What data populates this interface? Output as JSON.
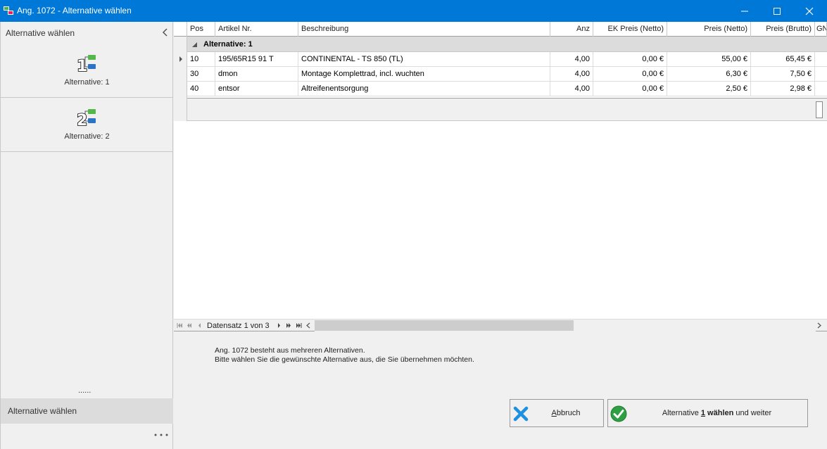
{
  "window": {
    "title": "Ang. 1072 - Alternative wählen"
  },
  "left_panel": {
    "header": "Alternative wählen",
    "items": [
      {
        "label": "Alternative: 1",
        "number": "1"
      },
      {
        "label": "Alternative: 2",
        "number": "2"
      }
    ],
    "dots": "......",
    "footer": "Alternative wählen"
  },
  "grid": {
    "columns": [
      "Pos",
      "Artikel Nr.",
      "Beschreibung",
      "Anz",
      "EK Preis (Netto)",
      "Preis (Netto)",
      "Preis (Brutto)",
      "GN"
    ],
    "group_label": "Alternative: 1",
    "rows": [
      {
        "pos": "10",
        "artikel": "195/65R15 91 T",
        "beschreibung": "CONTINENTAL - TS 850 (TL)",
        "anz": "4,00",
        "ek": "0,00 €",
        "netto": "55,00 €",
        "brutto": "65,45 €"
      },
      {
        "pos": "30",
        "artikel": "dmon",
        "beschreibung": "Montage Komplettrad, incl. wuchten",
        "anz": "4,00",
        "ek": "0,00 €",
        "netto": "6,30 €",
        "brutto": "7,50 €"
      },
      {
        "pos": "40",
        "artikel": "entsor",
        "beschreibung": "Altreifenentsorgung",
        "anz": "4,00",
        "ek": "0,00 €",
        "netto": "2,50 €",
        "brutto": "2,98 €"
      }
    ],
    "navigator": "Datensatz 1 von 3"
  },
  "info": {
    "line1": "Ang. 1072 besteht aus mehreren Alternativen.",
    "line2": "Bitte wählen Sie die gewünschte Alternative aus, die Sie übernehmen möchten."
  },
  "buttons": {
    "cancel_rest": "bbruch",
    "cancel_mnemonic": "A",
    "confirm_prefix": "Alternative ",
    "confirm_number": "1",
    "confirm_bold": " wählen",
    "confirm_suffix": " und weiter"
  },
  "colors": {
    "titlebar": "#0078d7",
    "cancel_icon": "#1e90e0",
    "ok_icon": "#2ea043"
  }
}
